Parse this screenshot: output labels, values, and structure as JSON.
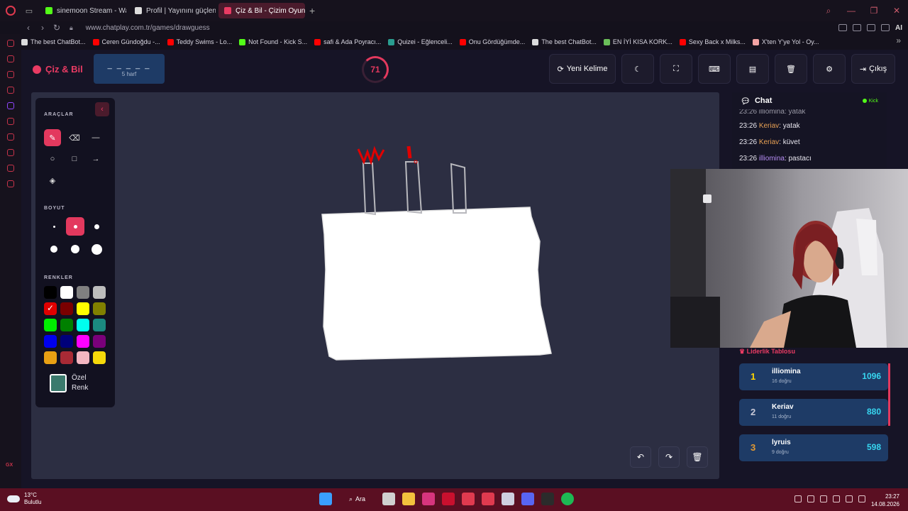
{
  "browser": {
    "tabs": [
      {
        "label": "sinemoon Stream - Wat",
        "fav": "#53fc18"
      },
      {
        "label": "Profil | Yayınını güçlendirme",
        "fav": "#dddddd"
      },
      {
        "label": "Çiz & Bil - Çizim Oyunu",
        "fav": "#e93b63",
        "active": true
      }
    ],
    "url": "www.chatplay.com.tr/games/drawguess",
    "ai_label": "AI",
    "bookmarks": [
      {
        "label": "The best ChatBot...",
        "fav": "#dddddd"
      },
      {
        "label": "Ceren Gündoğdu -...",
        "fav": "#ff0000"
      },
      {
        "label": "Teddy Swims - Lo...",
        "fav": "#ff0000"
      },
      {
        "label": "Not Found - Kick S...",
        "fav": "#53fc18"
      },
      {
        "label": "safi & Ada Poyracı...",
        "fav": "#ff0000"
      },
      {
        "label": "Quizei - Eğlenceli...",
        "fav": "#2a9d8f"
      },
      {
        "label": "Onu Gördüğümde...",
        "fav": "#ff0000"
      },
      {
        "label": "The best ChatBot...",
        "fav": "#dddddd"
      },
      {
        "label": "EN İYİ KISA KORK...",
        "fav": "#6bbf59"
      },
      {
        "label": "Sexy Back x Milks...",
        "fav": "#ff0000"
      },
      {
        "label": "X'ten Y'ye Yol - Oy...",
        "fav": "#f4a3a3"
      }
    ]
  },
  "app": {
    "brand": "Çiz & Bil",
    "word_blanks": "_ _ _ _ _",
    "word_hint": "5 harf",
    "timer": "71",
    "buttons": {
      "new_word": "Yeni Kelime",
      "exit": "Çıkış"
    }
  },
  "tools": {
    "section_tools": "ARAÇLAR",
    "section_size": "BOYUT",
    "section_colors": "RENKLER",
    "custom_color_line1": "Özel",
    "custom_color_line2": "Renk",
    "colors": [
      "#000000",
      "#ffffff",
      "#808080",
      "#bdbdbd",
      "#e00000",
      "#7a0000",
      "#ffff00",
      "#808000",
      "#00ee00",
      "#008000",
      "#00ffee",
      "#1b8a80",
      "#0000ee",
      "#00007a",
      "#ff00ff",
      "#7a007a",
      "#e8a013",
      "#a82a35",
      "#f4b6c2",
      "#f5d90a"
    ],
    "selected_color": "#e00000",
    "custom_color": "#3b7a6d"
  },
  "chat": {
    "title": "Chat",
    "platform": "Kick",
    "cut_message": "23:26 illiomina: yatak",
    "messages": [
      {
        "time": "23:26",
        "user": "Keriav",
        "text": "yatak",
        "color": "orange"
      },
      {
        "time": "23:26",
        "user": "Keriav",
        "text": "küvet",
        "color": "orange"
      },
      {
        "time": "23:26",
        "user": "illiomina",
        "text": "pastacı",
        "color": "purple"
      }
    ]
  },
  "leaderboard": {
    "title": "Liderlik Tablosu",
    "rows": [
      {
        "rank": "1",
        "name": "illiomina",
        "sub": "16 doğru",
        "points": "1096"
      },
      {
        "rank": "2",
        "name": "Keriav",
        "sub": "11 doğru",
        "points": "880"
      },
      {
        "rank": "3",
        "name": "lyruis",
        "sub": "9 doğru",
        "points": "598"
      }
    ]
  },
  "taskbar": {
    "temp": "13°C",
    "condition": "Bulutlu",
    "search": "Ara",
    "time": "23:27",
    "date": "14.08.2026"
  }
}
